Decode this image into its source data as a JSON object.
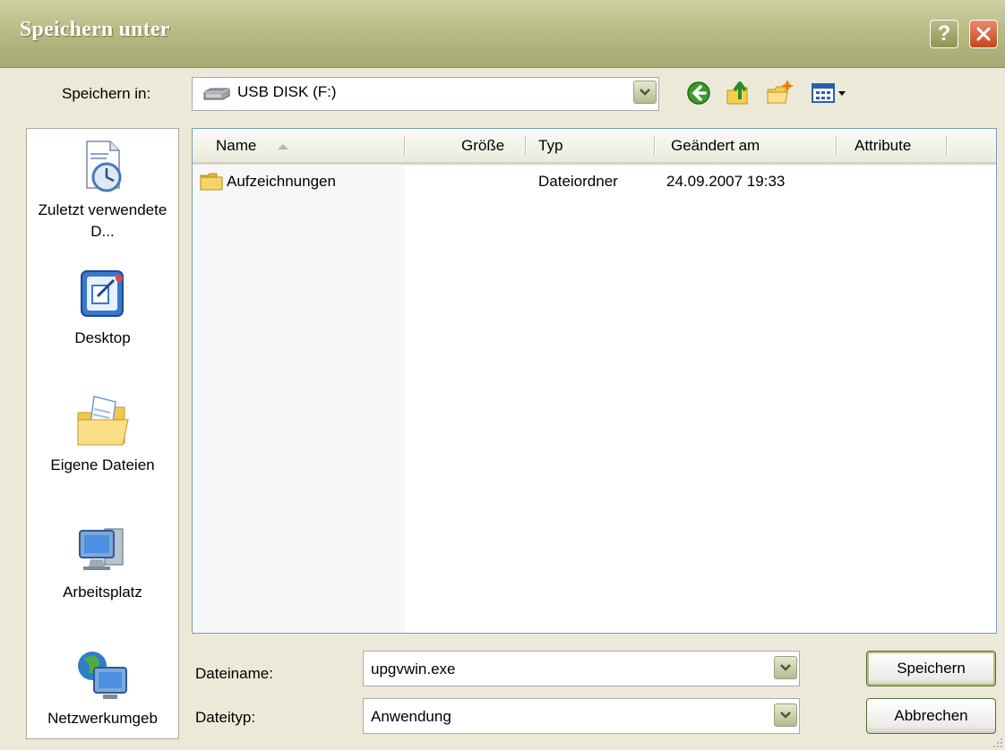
{
  "window": {
    "title": "Speichern unter",
    "help_button": "?",
    "close_button": "×"
  },
  "save_in": {
    "label": "Speichern in:",
    "value": "USB DISK (F:)"
  },
  "toolbar": {
    "icons": [
      "back-icon",
      "up-folder-icon",
      "new-folder-icon",
      "view-menu-icon"
    ]
  },
  "places": [
    {
      "label": "Zuletzt verwendete D...",
      "icon": "recent-documents-icon"
    },
    {
      "label": "Desktop",
      "icon": "desktop-icon"
    },
    {
      "label": "Eigene Dateien",
      "icon": "my-documents-icon"
    },
    {
      "label": "Arbeitsplatz",
      "icon": "my-computer-icon"
    },
    {
      "label": "Netzwerkumgeb",
      "icon": "network-places-icon"
    }
  ],
  "file_list": {
    "columns": [
      "Name",
      "Größe",
      "Typ",
      "Geändert am",
      "Attribute"
    ],
    "rows": [
      {
        "name": "Aufzeichnungen",
        "size": "",
        "type": "Dateiordner",
        "modified": "24.09.2007 19:33",
        "attributes": ""
      }
    ]
  },
  "filename": {
    "label": "Dateiname:",
    "value": "upgvwin.exe"
  },
  "filetype": {
    "label": "Dateityp:",
    "value": "Anwendung"
  },
  "buttons": {
    "save": "Speichern",
    "cancel": "Abbrechen"
  }
}
